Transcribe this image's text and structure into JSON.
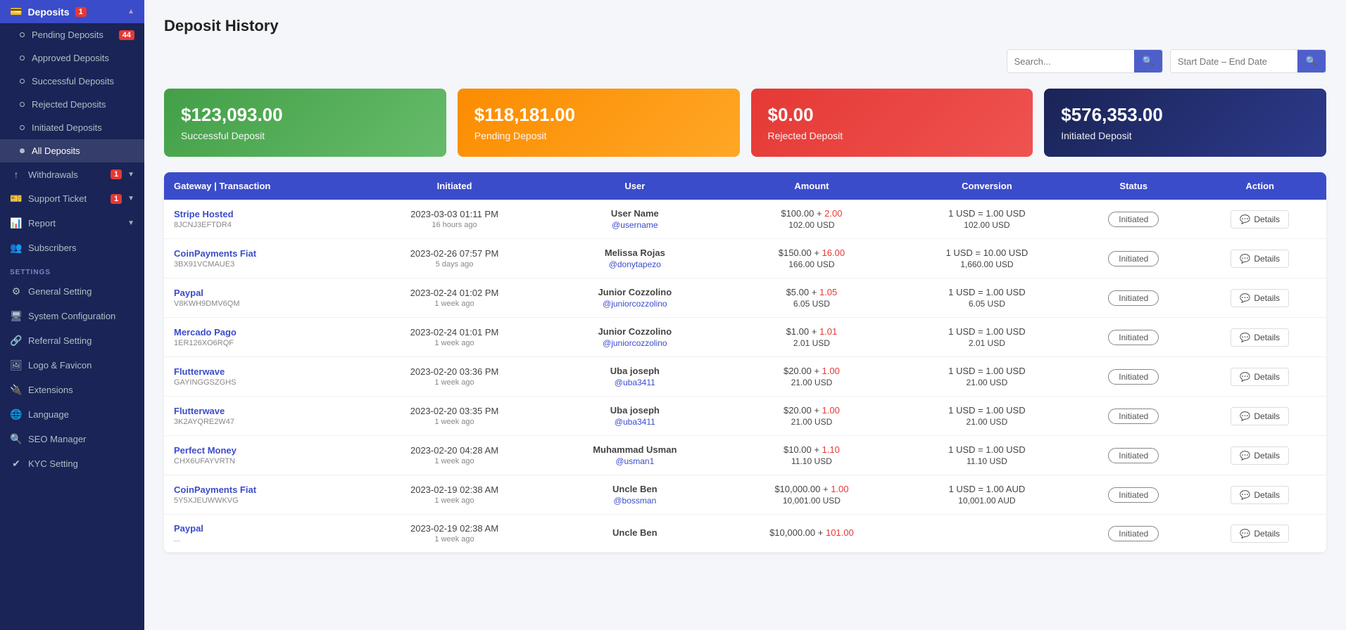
{
  "sidebar": {
    "deposits_label": "Deposits",
    "deposits_badge": "1",
    "pending_deposits_label": "Pending Deposits",
    "pending_deposits_badge": "44",
    "approved_deposits_label": "Approved Deposits",
    "successful_deposits_label": "Successful Deposits",
    "rejected_deposits_label": "Rejected Deposits",
    "initiated_deposits_label": "Initiated Deposits",
    "all_deposits_label": "All Deposits",
    "withdrawals_label": "Withdrawals",
    "withdrawals_badge": "1",
    "support_ticket_label": "Support Ticket",
    "support_ticket_badge": "1",
    "report_label": "Report",
    "subscribers_label": "Subscribers",
    "settings_label": "SETTINGS",
    "general_setting_label": "General Setting",
    "system_configuration_label": "System Configuration",
    "referral_setting_label": "Referral Setting",
    "logo_favicon_label": "Logo & Favicon",
    "extensions_label": "Extensions",
    "language_label": "Language",
    "seo_manager_label": "SEO Manager",
    "kyc_setting_label": "KYC Setting"
  },
  "page": {
    "title": "Deposit History"
  },
  "search": {
    "placeholder": "Search...",
    "date_placeholder": "Start Date – End Date"
  },
  "cards": [
    {
      "amount": "$123,093.00",
      "label": "Successful Deposit",
      "class": "card-green"
    },
    {
      "amount": "$118,181.00",
      "label": "Pending Deposit",
      "class": "card-orange"
    },
    {
      "amount": "$0.00",
      "label": "Rejected Deposit",
      "class": "card-red"
    },
    {
      "amount": "$576,353.00",
      "label": "Initiated Deposit",
      "class": "card-dark"
    }
  ],
  "table": {
    "headers": [
      "Gateway | Transaction",
      "Initiated",
      "User",
      "Amount",
      "Conversion",
      "Status",
      "Action"
    ],
    "rows": [
      {
        "gateway": "Stripe Hosted",
        "tx_id": "8JCNJ3EFTDR4",
        "initiated_date": "2023-03-03 01:11 PM",
        "initiated_ago": "16 hours ago",
        "user_name": "User Name",
        "user_handle": "@username",
        "amount_main": "$100.00 + ",
        "amount_fee": "2.00",
        "amount_total": "102.00 USD",
        "conv_rate": "1 USD = 1.00 USD",
        "conv_total": "102.00 USD",
        "status": "Initiated"
      },
      {
        "gateway": "CoinPayments Fiat",
        "tx_id": "3BX91VCMAUE3",
        "initiated_date": "2023-02-26 07:57 PM",
        "initiated_ago": "5 days ago",
        "user_name": "Melissa Rojas",
        "user_handle": "@donytapezo",
        "amount_main": "$150.00 + ",
        "amount_fee": "16.00",
        "amount_total": "166.00 USD",
        "conv_rate": "1 USD = 10.00 USD",
        "conv_total": "1,660.00 USD",
        "status": "Initiated"
      },
      {
        "gateway": "Paypal",
        "tx_id": "V8KWH9DMV6QM",
        "initiated_date": "2023-02-24 01:02 PM",
        "initiated_ago": "1 week ago",
        "user_name": "Junior Cozzolino",
        "user_handle": "@juniorcozzolino",
        "amount_main": "$5.00 + ",
        "amount_fee": "1.05",
        "amount_total": "6.05 USD",
        "conv_rate": "1 USD = 1.00 USD",
        "conv_total": "6.05 USD",
        "status": "Initiated"
      },
      {
        "gateway": "Mercado Pago",
        "tx_id": "1ER126XO6RQF",
        "initiated_date": "2023-02-24 01:01 PM",
        "initiated_ago": "1 week ago",
        "user_name": "Junior Cozzolino",
        "user_handle": "@juniorcozzolino",
        "amount_main": "$1.00 + ",
        "amount_fee": "1.01",
        "amount_total": "2.01 USD",
        "conv_rate": "1 USD = 1.00 USD",
        "conv_total": "2.01 USD",
        "status": "Initiated"
      },
      {
        "gateway": "Flutterwave",
        "tx_id": "GAYINGGSZGHS",
        "initiated_date": "2023-02-20 03:36 PM",
        "initiated_ago": "1 week ago",
        "user_name": "Uba joseph",
        "user_handle": "@uba3411",
        "amount_main": "$20.00 + ",
        "amount_fee": "1.00",
        "amount_total": "21.00 USD",
        "conv_rate": "1 USD = 1.00 USD",
        "conv_total": "21.00 USD",
        "status": "Initiated"
      },
      {
        "gateway": "Flutterwave",
        "tx_id": "3K2AYQRE2W47",
        "initiated_date": "2023-02-20 03:35 PM",
        "initiated_ago": "1 week ago",
        "user_name": "Uba joseph",
        "user_handle": "@uba3411",
        "amount_main": "$20.00 + ",
        "amount_fee": "1.00",
        "amount_total": "21.00 USD",
        "conv_rate": "1 USD = 1.00 USD",
        "conv_total": "21.00 USD",
        "status": "Initiated"
      },
      {
        "gateway": "Perfect Money",
        "tx_id": "CHX6UFAYVRTN",
        "initiated_date": "2023-02-20 04:28 AM",
        "initiated_ago": "1 week ago",
        "user_name": "Muhammad Usman",
        "user_handle": "@usman1",
        "amount_main": "$10.00 + ",
        "amount_fee": "1.10",
        "amount_total": "11.10 USD",
        "conv_rate": "1 USD = 1.00 USD",
        "conv_total": "11.10 USD",
        "status": "Initiated"
      },
      {
        "gateway": "CoinPayments Fiat",
        "tx_id": "5Y5XJEUWWKVG",
        "initiated_date": "2023-02-19 02:38 AM",
        "initiated_ago": "1 week ago",
        "user_name": "Uncle Ben",
        "user_handle": "@bossman",
        "amount_main": "$10,000.00 + ",
        "amount_fee": "1.00",
        "amount_total": "10,001.00 USD",
        "conv_rate": "1 USD = 1.00 AUD",
        "conv_total": "10,001.00 AUD",
        "status": "Initiated"
      },
      {
        "gateway": "Paypal",
        "tx_id": "...",
        "initiated_date": "2023-02-19 02:38 AM",
        "initiated_ago": "1 week ago",
        "user_name": "Uncle Ben",
        "user_handle": "",
        "amount_main": "$10,000.00 + ",
        "amount_fee": "101.00",
        "amount_total": "",
        "conv_rate": "",
        "conv_total": "",
        "status": "Initiated"
      }
    ],
    "details_label": "Details"
  }
}
